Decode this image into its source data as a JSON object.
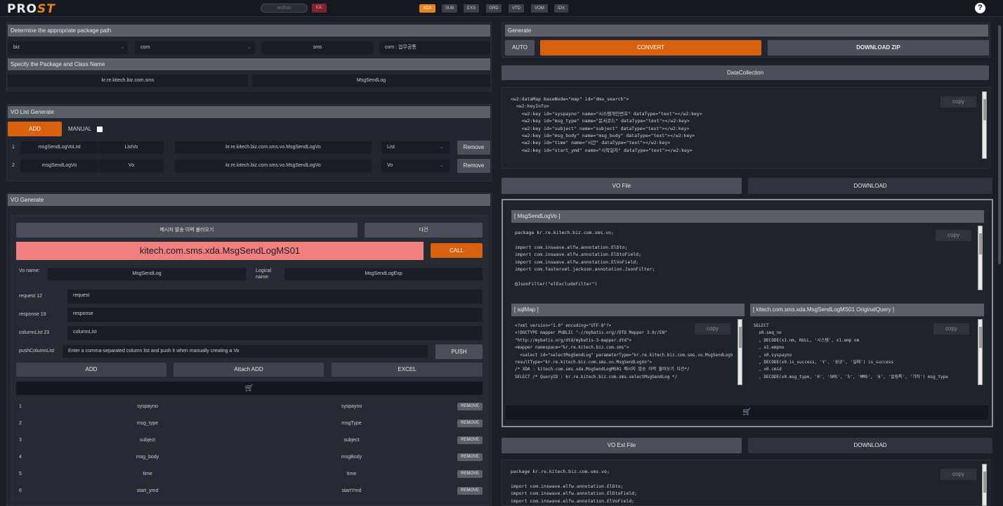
{
  "app": {
    "logo_text": "PRO",
    "logo_accent": "ST",
    "accent_color": "#e8821e",
    "search_placeholder": "author",
    "badge": "IOL"
  },
  "tabs": [
    "XDA",
    "SUB",
    "EXS",
    "GRD",
    "VTD",
    "VOM",
    "IDX"
  ],
  "active_tab": "XDA",
  "help_label": "?",
  "left": {
    "package_path": {
      "header": "Determine the appropriate package path",
      "fields": [
        "biz",
        "com",
        "sms",
        "com : 업무공통"
      ]
    },
    "package_class": {
      "header": "Specify the Package and Class Name",
      "package": "kr.re.kitech.biz.com.sms",
      "class_name": "MsgSendLog"
    },
    "vo_list": {
      "header": "VO List Generate",
      "add_label": "ADD",
      "manual_label": "MANUAL",
      "rows": [
        {
          "no": "1",
          "name": "msgSendLogVoList",
          "type": "ListVo",
          "path": "kr.re.kitech.biz.com.sms.vo.MsgSendLogVo",
          "kind": "List",
          "action": "Remove"
        },
        {
          "no": "2",
          "name": "msgSendLogVo",
          "type": "Vo",
          "path": "kr.re.kitech.biz.com.sms.vo.MsgSendLogVo",
          "kind": "Vo",
          "action": "Remove"
        }
      ]
    },
    "vo_generate": {
      "header": "VO Generate",
      "fetch_label": "메시지 발송 이력 불러오기",
      "other_label": "다건",
      "xda_value": "kitech.com.sms.xda.MsgSendLogMS01",
      "call_label": "CALL",
      "vo_name_label": "Vo name:",
      "vo_name_value": "MsgSendLog",
      "logical_name_label": "Logical name:",
      "logical_name_value": "MsgSendLogExp",
      "request_label": "request 12",
      "request_value": "request",
      "response_label": "response 19",
      "response_value": "response",
      "column_label": "columnList 23",
      "column_value": "columnList",
      "push_label": "pushColumnList",
      "push_placeholder": "Enter a comma-separated column list and push it when manually creating a Vo",
      "push_button": "PUSH",
      "add_button": "ADD",
      "attach_button": "Attach ADD",
      "excel_button": "EXCEL",
      "cart_icon": "cart-icon",
      "columns": [
        {
          "no": "1",
          "col": "syspayno",
          "field": "syspayno",
          "action": "REMOVE"
        },
        {
          "no": "2",
          "col": "msg_type",
          "field": "msgType",
          "action": "REMOVE"
        },
        {
          "no": "3",
          "col": "subject",
          "field": "subject",
          "action": "REMOVE"
        },
        {
          "no": "4",
          "col": "msg_body",
          "field": "msgBody",
          "action": "REMOVE"
        },
        {
          "no": "5",
          "col": "time",
          "field": "time",
          "action": "REMOVE"
        },
        {
          "no": "6",
          "col": "start_ymd",
          "field": "startYmd",
          "action": "REMOVE"
        }
      ]
    }
  },
  "right": {
    "generate_header": "Generate",
    "auto_label": "AUTO",
    "convert_label": "CONVERT",
    "download_zip_label": "DOWNLOAD ZIP",
    "data_collection_label": "DataCollection",
    "copy_label": "copy",
    "data_collection_code": "<w2:dataMap baseNode=\"map\" id=\"dma_search\">\n  <w2:keyInfo>\n    <w2:key id=\"syspayno\" name=\"시스템개인번호\" dataType=\"text\"></w2:key>\n    <w2:key id=\"msg_type\" name=\"문서코드\" dataType=\"text\"></w2:key>\n    <w2:key id=\"subject\" name=\"subject\" dataType=\"text\"></w2:key>\n    <w2:key id=\"msg_body\" name=\"msg_body\" dataType=\"text\"></w2:key>\n    <w2:key id=\"time\" name=\"시간\" dataType=\"text\"></w2:key>\n    <w2:key id=\"start_ymd\" name=\"시작일자\" dataType=\"text\"></w2:key>",
    "vo_file_label": "VO File",
    "download_label": "DOWNLOAD",
    "vo_class_header": "[ MsgSendLogVo ]",
    "vo_code": "package kr.re.kitech.biz.com.sms.vo;\n\nimport com.inswave.elfw.annotation.ElDto;\nimport com.inswave.elfw.annotation.ElDtoField;\nimport com.inswave.elfw.annotation.ElVoField;\nimport com.fasterxml.jackson.annotation.JsonFilter;\n\n@JsonFilter(\"elExcludeFilter\")",
    "sqlmap_header": "[ sqlMap ]",
    "sqlmap_code": "<?xml version=\"1.0\" encoding=\"UTF-8\"?>\n<!DOCTYPE mapper PUBLIC \"-//mybatis.org//DTD Mapper 3.0//EN\"\n\"http://mybatis.org/dtd/mybatis-3-mapper.dtd\">\n<mapper namespace=\"kr.re.kitech.biz.com.sms\">\n  <select id=\"selectMsgSendLog\" parameterType=\"kr.re.kitech.biz.com.sms.vo.MsgSendLogVo\"\nresultType=\"kr.re.kitech.biz.com.sms.vo.MsgSendLogVo\">\n/* XDA : kitech.com.sms.xda.MsgSendLogMS01 메시지 발송 이력 불러오기 다건*/\nSELECT /* QueryID : kr.re.kitech.biz.com.sms.selectMsgSendLog */",
    "query_header": "[ kitech.com.sms.xda.MsgSendLogMS01 OriginalQuery ]",
    "query_code": "SELECT\n  x0.seq_no\n  , DECODE(x1.nm, NULL, '시스템', x1.emp nm\n  , x1.empno\n  , x0.syspayno\n  , DECODE(x0.is_success, 'Y', '성공', '실패') is_success\n  , x0.cmid\n  , DECODE(x0.msg_type, '0', 'SMS', '5', 'MMS', '6', '알림톡', '기타') msg_type",
    "vo_ext_label": "VO Ext File",
    "vo_ext_code": "package kr.re.kitech.biz.com.sms.vo;\n\nimport com.inswave.elfw.annotation.ElDto;\nimport com.inswave.elfw.annotation.ElDtoField;\nimport com.inswave.elfw.annotation.ElVoField;"
  }
}
